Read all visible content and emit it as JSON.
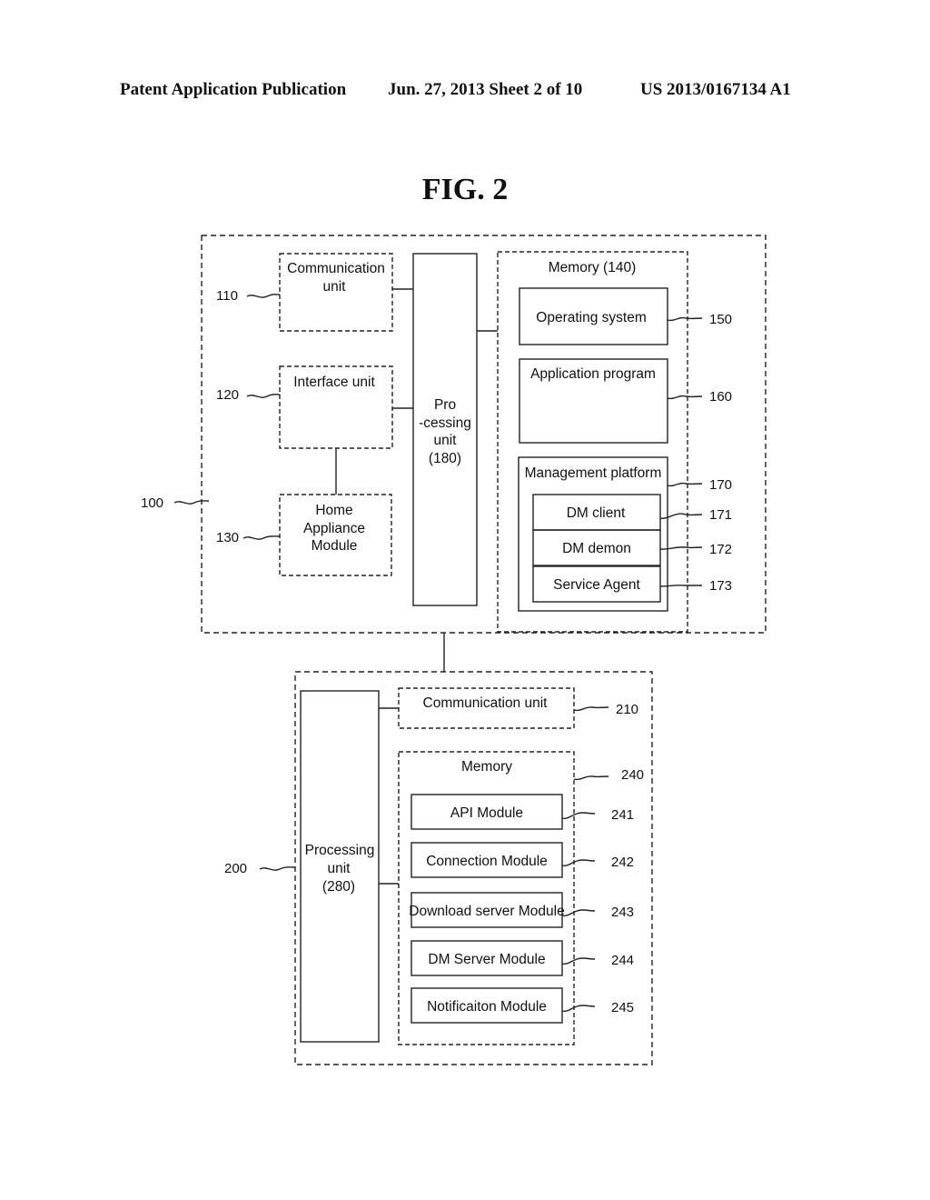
{
  "header": {
    "publication": "Patent Application Publication",
    "date_sheet": "Jun. 27, 2013  Sheet 2 of 10",
    "patent_number": "US 2013/0167134 A1"
  },
  "figure": {
    "title": "FIG. 2"
  },
  "device_100": {
    "ref": "100",
    "communication_unit": {
      "label_line1": "Communication",
      "label_line2": "unit",
      "ref": "110"
    },
    "interface_unit": {
      "label": "Interface unit",
      "ref": "120"
    },
    "home_appliance_module": {
      "line1": "Home",
      "line2": "Appliance",
      "line3": "Module",
      "ref": "130"
    },
    "processing_unit": {
      "line1": "Pro",
      "line2": "-cessing",
      "line3": "unit",
      "line4": "(180)"
    },
    "memory": {
      "label": "Memory  (140)",
      "operating_system": {
        "label": "Operating system",
        "ref": "150"
      },
      "application_program": {
        "label": "Application program",
        "ref": "160"
      },
      "management_platform": {
        "label": "Management platform",
        "ref": "170",
        "items": [
          {
            "label": "DM client",
            "ref": "171"
          },
          {
            "label": "DM demon",
            "ref": "172"
          },
          {
            "label": "Service Agent",
            "ref": "173"
          }
        ]
      }
    }
  },
  "server_200": {
    "ref": "200",
    "processing_unit": {
      "line1": "Processing",
      "line2": "unit",
      "line3": "(280)"
    },
    "communication_unit": {
      "label": "Communication unit",
      "ref": "210"
    },
    "memory": {
      "label": "Memory",
      "ref": "240",
      "modules": [
        {
          "label": "API Module",
          "ref": "241"
        },
        {
          "label": "Connection Module",
          "ref": "242"
        },
        {
          "label": "Download server Module",
          "ref": "243"
        },
        {
          "label": "DM Server Module",
          "ref": "244"
        },
        {
          "label": "Notificaiton Module",
          "ref": "245"
        }
      ]
    }
  }
}
